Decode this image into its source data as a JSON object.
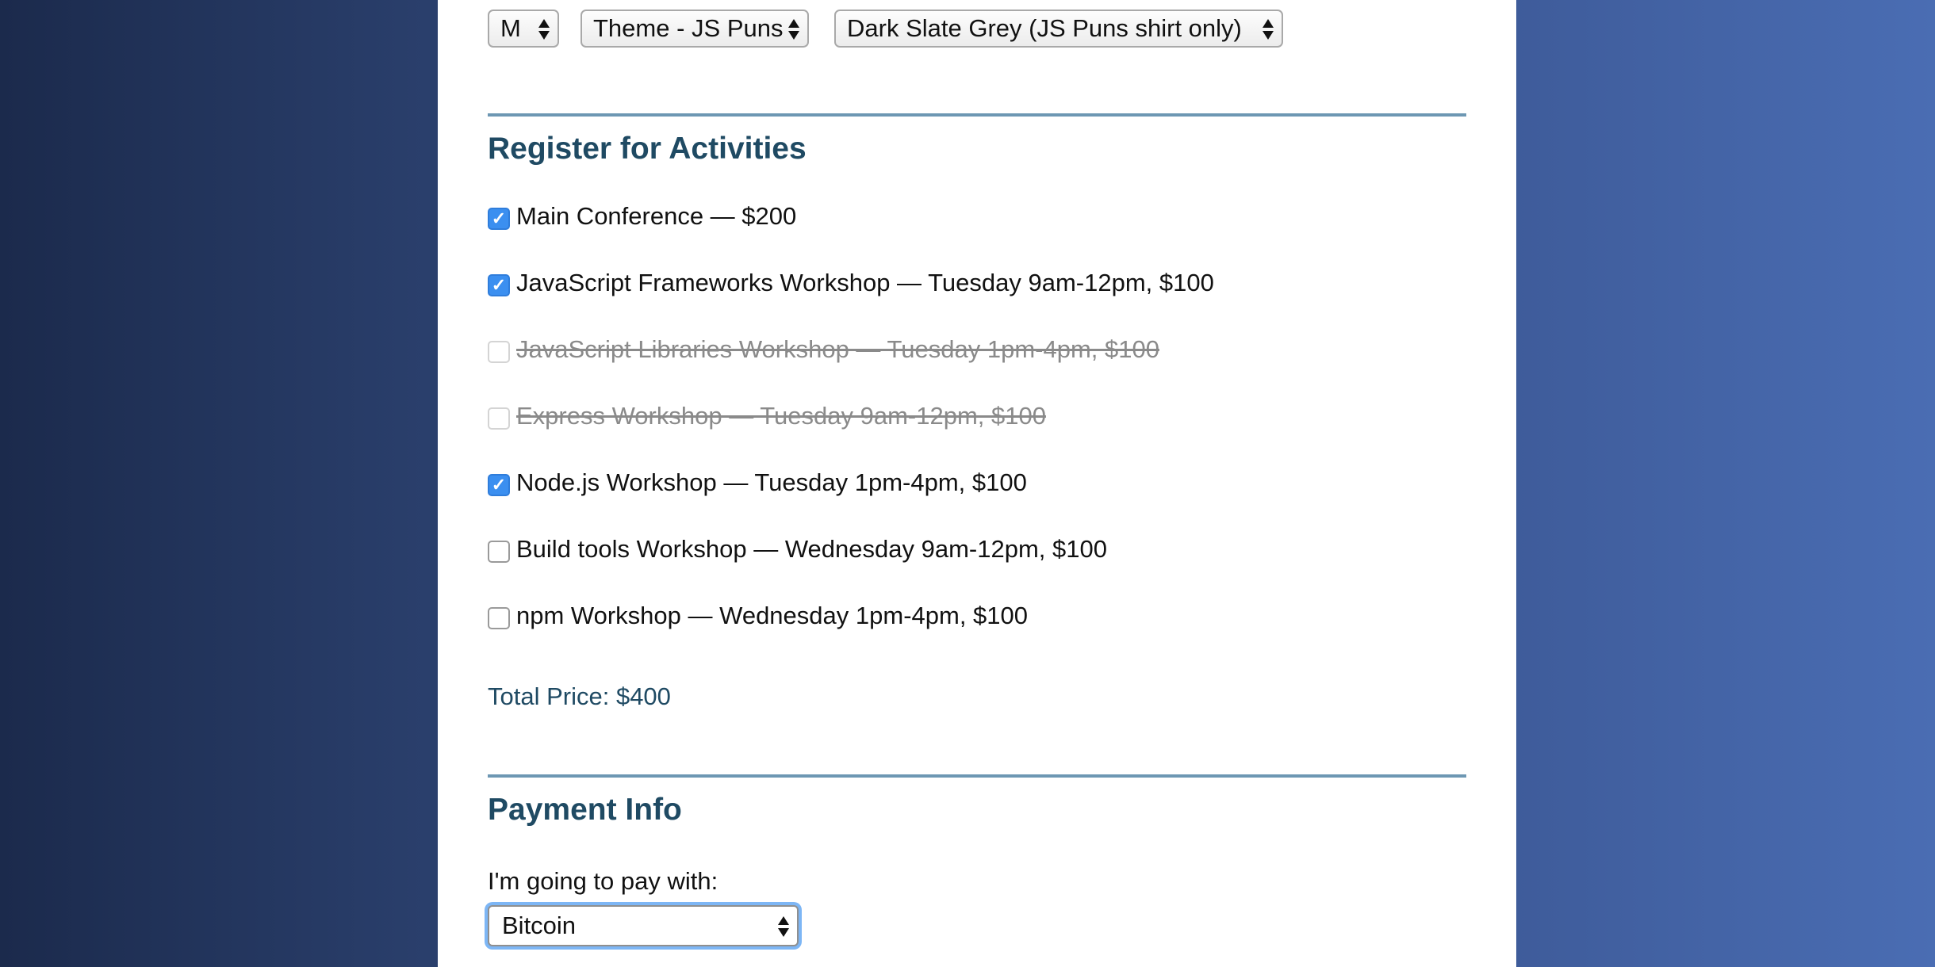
{
  "shirt": {
    "size": "M",
    "design": "Theme - JS Puns",
    "color": "Dark Slate Grey (JS Puns shirt only)"
  },
  "activities": {
    "heading": "Register for Activities",
    "items": [
      {
        "label": "Main Conference — $200",
        "checked": true,
        "disabled": false
      },
      {
        "label": "JavaScript Frameworks Workshop — Tuesday 9am-12pm, $100",
        "checked": true,
        "disabled": false
      },
      {
        "label": "JavaScript Libraries Workshop — Tuesday 1pm-4pm, $100",
        "checked": false,
        "disabled": true
      },
      {
        "label": "Express Workshop — Tuesday 9am-12pm, $100",
        "checked": false,
        "disabled": true
      },
      {
        "label": "Node.js Workshop — Tuesday 1pm-4pm, $100",
        "checked": true,
        "disabled": false
      },
      {
        "label": "Build tools Workshop — Wednesday 9am-12pm, $100",
        "checked": false,
        "disabled": false
      },
      {
        "label": "npm Workshop — Wednesday 1pm-4pm, $100",
        "checked": false,
        "disabled": false
      }
    ],
    "total": "Total Price: $400"
  },
  "payment": {
    "heading": "Payment Info",
    "label": "I'm going to pay with:",
    "method": "Bitcoin"
  },
  "colors": {
    "heading": "#1f4a63",
    "rule": "#6d97b3",
    "checkbox_checked": "#3b8ff0"
  }
}
